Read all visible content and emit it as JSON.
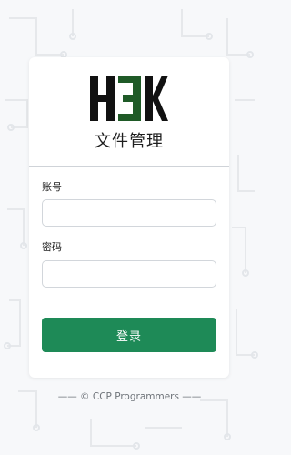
{
  "app": {
    "logo_text": "H3K",
    "title": "文件管理"
  },
  "form": {
    "account_label": "账号",
    "account_value": "",
    "password_label": "密码",
    "password_value": "",
    "submit_label": "登录"
  },
  "footer": {
    "text": "—— © CCP Programmers ——"
  },
  "colors": {
    "accent": "#1e8a57",
    "logo_dark": "#111111",
    "logo_green": "#1f5a27"
  }
}
